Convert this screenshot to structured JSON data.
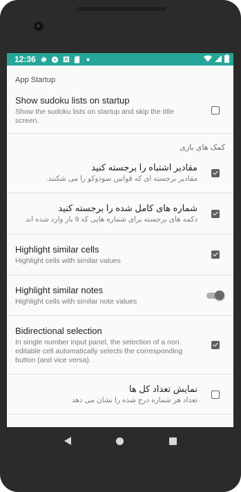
{
  "status_bar": {
    "time": "12:36",
    "icons_left": [
      "gear-icon",
      "play-icon",
      "a-box-icon",
      "sd-card-icon",
      "dot-icon"
    ],
    "icons_right": [
      "wifi-icon",
      "signal-icon",
      "battery-icon"
    ]
  },
  "sections": {
    "app_startup": "App Startup",
    "game_help": "کمک های بازی"
  },
  "settings": [
    {
      "title": "Show sudoku lists on startup",
      "summary": "Show the sudoku lists on startup and skip the title screen.",
      "control": "checkbox",
      "checked": false
    },
    {
      "title": "مقادیر اشتباه را برجسته کنید",
      "summary": "مقادیر برجسته ای که قوانین سودوکو را می شکنند.",
      "control": "checkbox",
      "checked": true
    },
    {
      "title": "شماره های کامل شده را برجسته کنید",
      "summary": "دکمه های برجسته برای شماره هایی که 9 بار وارد شده اند",
      "control": "checkbox",
      "checked": true
    },
    {
      "title": "Highlight similar cells",
      "summary": "Highlight cells with similar values",
      "control": "checkbox",
      "checked": true
    },
    {
      "title": "Highlight similar notes",
      "summary": "Highlight cells with similar note values",
      "control": "switch",
      "checked": true
    },
    {
      "title": "Bidirectional selection",
      "summary": "In single number input panel, the selection of a non editable cell automatically selects the corresponding button (and vice versa).",
      "control": "checkbox",
      "checked": true
    },
    {
      "title": "نمایش تعداد کل ها",
      "summary": "تعداد هر شماره درج شده را نشان می دهد",
      "control": "checkbox",
      "checked": false
    }
  ],
  "colors": {
    "status_bar": "#26a69a",
    "background": "#fafafa",
    "control": "#5f5f5f"
  }
}
